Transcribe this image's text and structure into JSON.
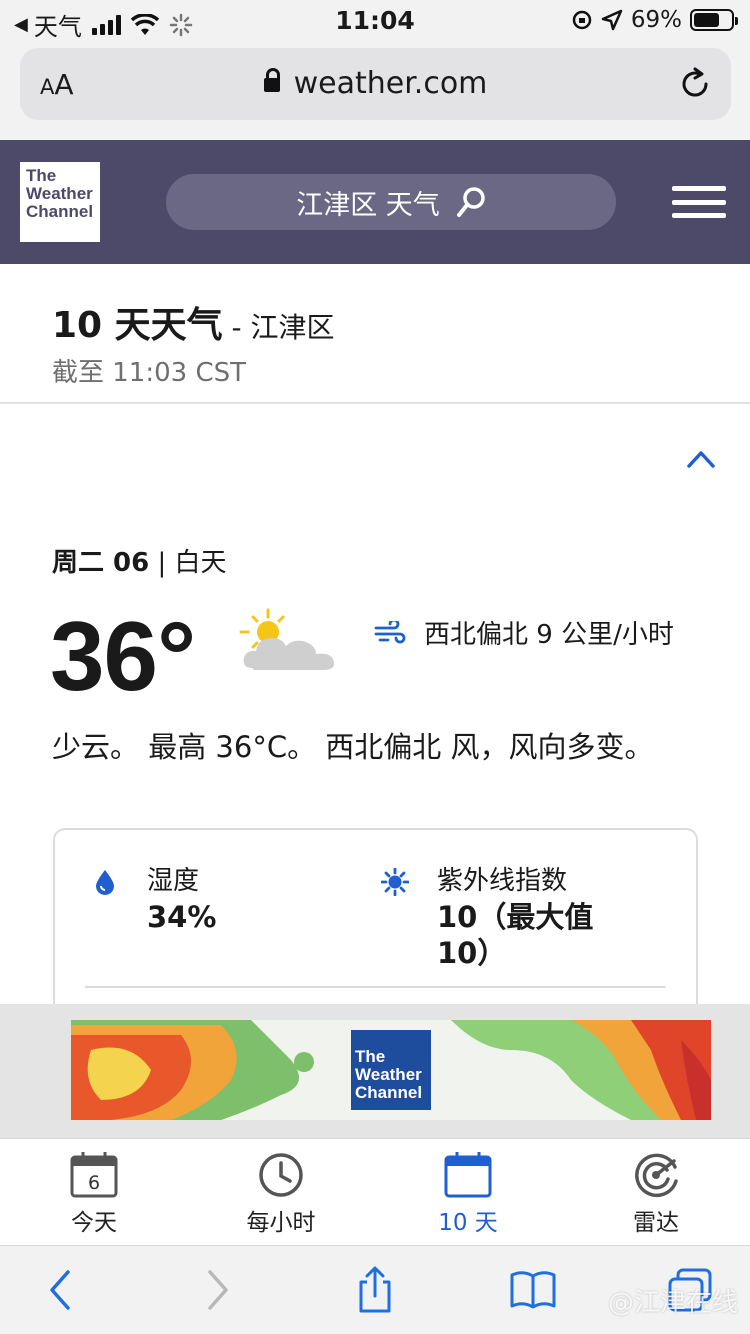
{
  "status_bar": {
    "back_app": "天气",
    "time": "11:04",
    "battery": "69%",
    "battery_level": 0.69
  },
  "browser": {
    "text_size_small": "A",
    "text_size_big": "A",
    "url": "weather.com"
  },
  "site_header": {
    "logo_line1": "The",
    "logo_line2": "Weather",
    "logo_line3": "Channel",
    "search_text": "江津区 天气"
  },
  "page": {
    "title": "10 天天气",
    "title_sep": " - ",
    "location": "江津区",
    "as_of": "截至 11:03 CST"
  },
  "day": {
    "name": "周二 06",
    "sep": " | ",
    "period": "白天",
    "temperature": "36°",
    "wind": "西北偏北 9 公里/小时",
    "narrative": "少云。 最高 36°C。 西北偏北 风，风向多变。",
    "humidity_label": "湿度",
    "humidity_value": "34%",
    "uv_label": "紫外线指数",
    "uv_value_line1": "10（最大值",
    "uv_value_line2": "10）"
  },
  "ad": {
    "logo_line1": "The",
    "logo_line2": "Weather",
    "logo_line3": "Channel"
  },
  "tabs": [
    {
      "label": "今天",
      "icon_text": "6"
    },
    {
      "label": "每小时"
    },
    {
      "label": "10 天"
    },
    {
      "label": "雷达"
    }
  ],
  "watermark": "@江津在线",
  "colors": {
    "header": "#4d4a69",
    "accent": "#1f5fd1"
  }
}
